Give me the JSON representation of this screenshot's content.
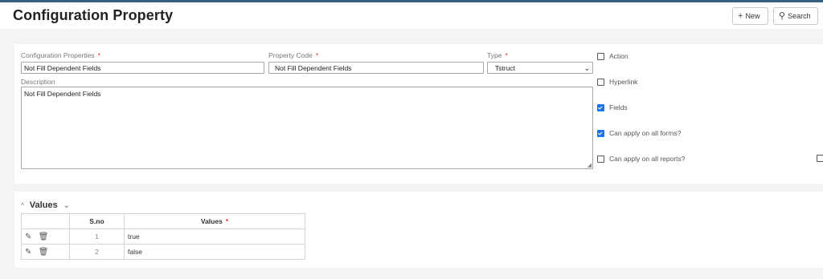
{
  "header": {
    "title": "Configuration Property",
    "new_label": "New",
    "search_label": "Search",
    "plus_glyph": "+",
    "search_glyph": "⚲"
  },
  "form": {
    "config_properties": {
      "label": "Configuration Properties",
      "value": "Not Fill Dependent Fields"
    },
    "property_code": {
      "label": "Property Code",
      "value": "Not Fill Dependent Fields"
    },
    "type": {
      "label": "Type",
      "value": "Tstruct"
    },
    "description": {
      "label": "Description",
      "value": "Not Fill Dependent Fields"
    },
    "required_mark": "*",
    "caret_glyph": "⌄",
    "grip_glyph": "◢"
  },
  "checkboxes": [
    {
      "label": "Action",
      "checked": false
    },
    {
      "label": "Hyperlink",
      "checked": false
    },
    {
      "label": "Fields",
      "checked": true
    },
    {
      "label": "Can apply on all forms?",
      "checked": true
    },
    {
      "label": "Can apply on all reports?",
      "checked": false
    }
  ],
  "values_section": {
    "title": "Values",
    "collapse_glyph": "^",
    "chevron_glyph": "⌄",
    "columns": [
      "S.no",
      "Values"
    ],
    "required_mark": "*",
    "edit_glyph": "✎",
    "delete_glyph": "🗑",
    "rows": [
      {
        "sno": "1",
        "value": "true"
      },
      {
        "sno": "2",
        "value": "false"
      }
    ]
  }
}
